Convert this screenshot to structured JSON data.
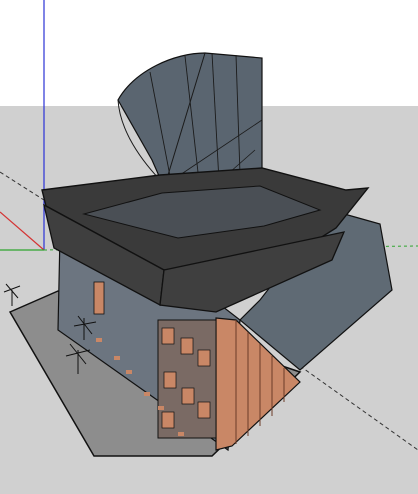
{
  "viewport": {
    "sky_color": "#ffffff",
    "ground_color": "#d0d0d0",
    "axis_colors": {
      "blue": "#2b32d6",
      "red": "#d43434",
      "green": "#2ea52e"
    }
  },
  "model": {
    "roof_color": "#3a3a3a",
    "glass_color": "#5d6873",
    "wood_color": "#c98766",
    "plaza_color": "#8d8d8d"
  }
}
